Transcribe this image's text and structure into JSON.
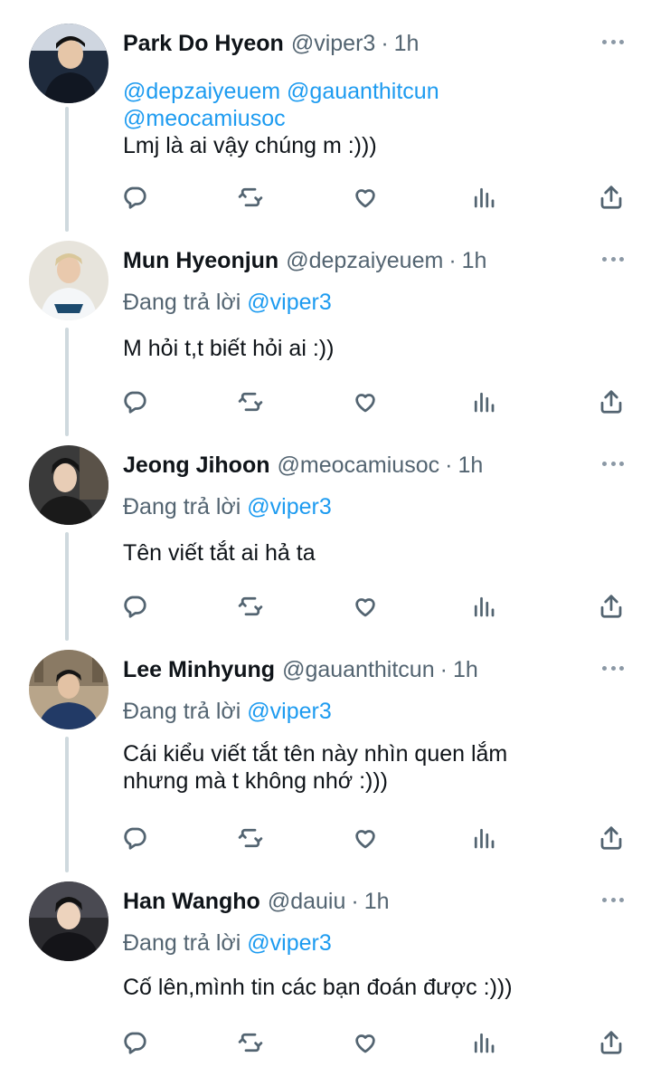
{
  "tweets": [
    {
      "name": "Park Do Hyeon",
      "handle": "@viper3",
      "dot": "·",
      "time": "1h",
      "mentions": [
        "@depzaiyeuem",
        "@gauanthitcun",
        "@meocamiusoc"
      ],
      "text": "Lmj là ai vậy chúng m :)))",
      "avatar_bg": "#1f2b3d"
    },
    {
      "name": "Mun Hyeonjun",
      "handle": "@depzaiyeuem",
      "dot": "·",
      "time": "1h",
      "replying_prefix": "Đang trả lời",
      "replying_to": "@viper3",
      "text": "M hỏi t,t biết hỏi ai :))",
      "avatar_bg": "#e7e4dc"
    },
    {
      "name": "Jeong Jihoon",
      "handle": "@meocamiusoc",
      "dot": "·",
      "time": "1h",
      "replying_prefix": "Đang trả lời",
      "replying_to": "@viper3",
      "text": "Tên viết tắt ai hả ta",
      "avatar_bg": "#3a3a3a"
    },
    {
      "name": "Lee Minhyung",
      "handle": "@gauanthitcun",
      "dot": "·",
      "time": "1h",
      "replying_prefix": "Đang trả lời",
      "replying_to": "@viper3",
      "text_lines": [
        "Cái kiểu viết tắt tên này nhìn quen lắm",
        "nhưng mà t không nhớ :)))"
      ],
      "avatar_bg": "#b8a58a"
    },
    {
      "name": "Han Wangho",
      "handle": "@dauiu",
      "dot": "·",
      "time": "1h",
      "replying_prefix": "Đang trả lời",
      "replying_to": "@viper3",
      "text": "Cố lên,mình tin các bạn đoán được :)))",
      "avatar_bg": "#2a2a2e"
    }
  ],
  "icons": {
    "reply": "reply-icon",
    "retweet": "retweet-icon",
    "like": "heart-icon",
    "views": "views-icon",
    "share": "share-icon",
    "more": "more-icon"
  },
  "colors": {
    "mention": "#1d9bf0",
    "secondary_text": "#536471",
    "thread_line": "#cfd9de"
  }
}
